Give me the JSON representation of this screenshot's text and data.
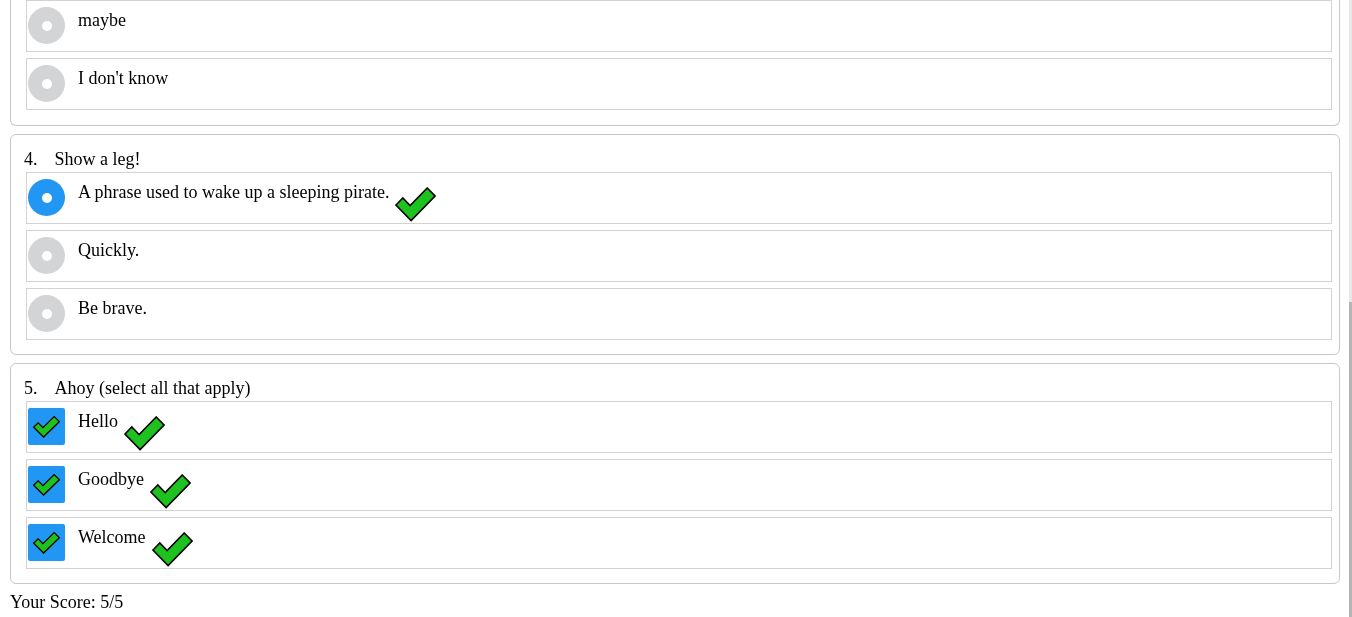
{
  "questions": [
    {
      "kind": "radio",
      "options": [
        {
          "label": "maybe",
          "selected": false,
          "correct_mark": false
        },
        {
          "label": "I don't know",
          "selected": false,
          "correct_mark": false
        }
      ]
    },
    {
      "kind": "radio",
      "number": "4.",
      "title": "Show a leg!",
      "options": [
        {
          "label": "A phrase used to wake up a sleeping pirate.",
          "selected": true,
          "correct_mark": true
        },
        {
          "label": "Quickly.",
          "selected": false,
          "correct_mark": false
        },
        {
          "label": "Be brave.",
          "selected": false,
          "correct_mark": false
        }
      ]
    },
    {
      "kind": "checkbox",
      "number": "5.",
      "title": "Ahoy (select all that apply)",
      "options": [
        {
          "label": "Hello",
          "checked": true,
          "correct_mark": true
        },
        {
          "label": "Goodbye",
          "checked": true,
          "correct_mark": true
        },
        {
          "label": "Welcome",
          "checked": true,
          "correct_mark": true
        }
      ]
    }
  ],
  "score": "Your Score: 5/5"
}
